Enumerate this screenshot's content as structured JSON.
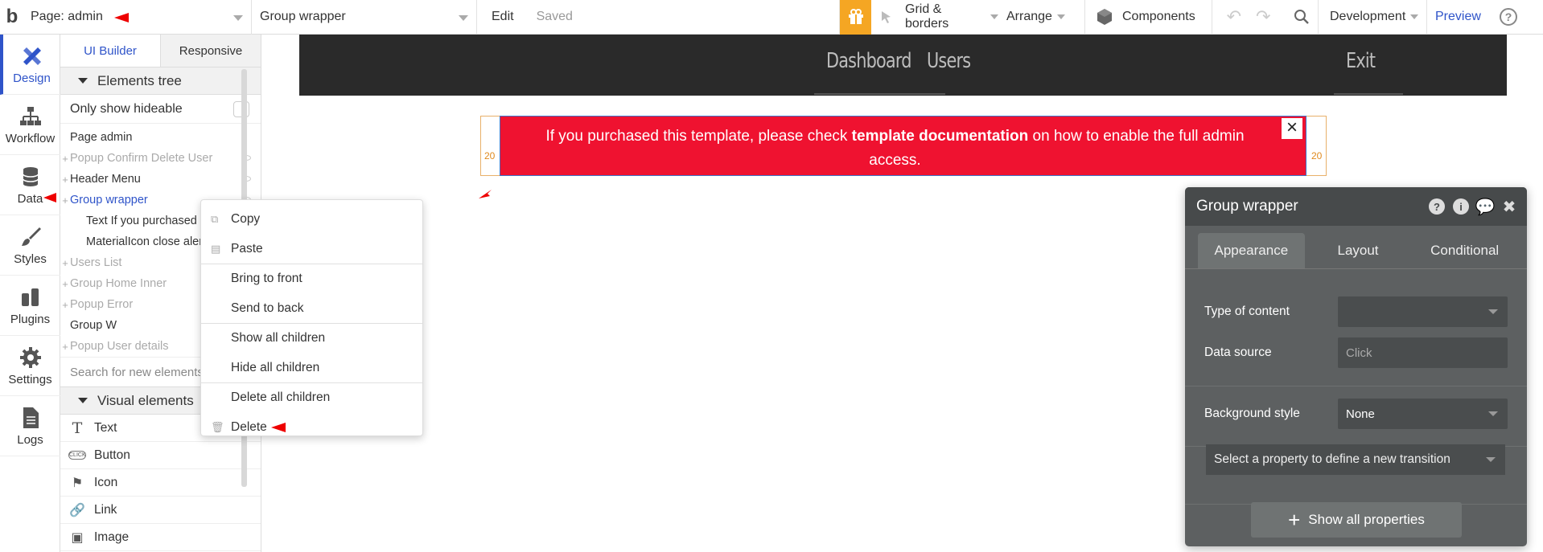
{
  "topbar": {
    "logo": "b",
    "page_select": "Page: admin",
    "element_select": "Group wrapper",
    "edit": "Edit",
    "saved": "Saved",
    "grid": "Grid & borders",
    "arrange": "Arrange",
    "components": "Components",
    "environment": "Development",
    "preview": "Preview",
    "help": "?"
  },
  "rail": [
    "Design",
    "Workflow",
    "Data",
    "Styles",
    "Plugins",
    "Settings",
    "Logs"
  ],
  "panel": {
    "tabs": [
      "UI Builder",
      "Responsive"
    ],
    "tree_header": "Elements tree",
    "only_hideable": "Only show hideable",
    "tree": [
      {
        "label": "Page admin",
        "state": "normal",
        "indent": 0,
        "plus": false
      },
      {
        "label": "Popup Confirm Delete User",
        "state": "muted",
        "indent": 0,
        "plus": true
      },
      {
        "label": "Header Menu",
        "state": "normal",
        "indent": 0,
        "plus": true
      },
      {
        "label": "Group wrapper",
        "state": "selected",
        "indent": 0,
        "plus": true
      },
      {
        "label": "Text If you purchased th",
        "state": "normal",
        "indent": 1,
        "plus": false
      },
      {
        "label": "MaterialIcon close alert",
        "state": "normal",
        "indent": 1,
        "plus": false
      },
      {
        "label": "Users List",
        "state": "muted",
        "indent": 0,
        "plus": true
      },
      {
        "label": "Group Home Inner",
        "state": "muted",
        "indent": 0,
        "plus": true
      },
      {
        "label": "Popup Error",
        "state": "muted",
        "indent": 0,
        "plus": true
      },
      {
        "label": "Group W",
        "state": "normal",
        "indent": 0,
        "plus": false
      },
      {
        "label": "Popup User details",
        "state": "muted",
        "indent": 0,
        "plus": true
      }
    ],
    "search_placeholder": "Search for new elements",
    "visual_header": "Visual elements",
    "visual": [
      {
        "label": "Text",
        "icon": "T"
      },
      {
        "label": "Button",
        "icon": "CLICK"
      },
      {
        "label": "Icon",
        "icon": "⚑"
      },
      {
        "label": "Link",
        "icon": "🔗"
      },
      {
        "label": "Image",
        "icon": "▣"
      }
    ]
  },
  "canvas": {
    "nav": [
      "Dashboard",
      "Users",
      "Exit"
    ],
    "alert_text_before": "If you purchased this template, please check ",
    "alert_text_bold": "template documentation",
    "alert_text_after": " on how to enable the full admin access.",
    "alert_close": "×",
    "padding_left": "20",
    "padding_right": "20"
  },
  "context_menu": [
    "Copy",
    "Paste",
    "Bring to front",
    "Send to back",
    "Show all children",
    "Hide all children",
    "Delete all children",
    "Delete"
  ],
  "props": {
    "title": "Group wrapper",
    "tabs": [
      "Appearance",
      "Layout",
      "Conditional"
    ],
    "type_of_content_label": "Type of content",
    "type_of_content_value": "",
    "data_source_label": "Data source",
    "data_source_value": "Click",
    "background_label": "Background style",
    "background_value": "None",
    "transition": "Select a property to define a new transition",
    "show_all": "Show all properties"
  },
  "colors": {
    "accent": "#2f54c9",
    "alert": "#ef1230",
    "gift": "#f5a623",
    "annotation": "#e00000"
  }
}
